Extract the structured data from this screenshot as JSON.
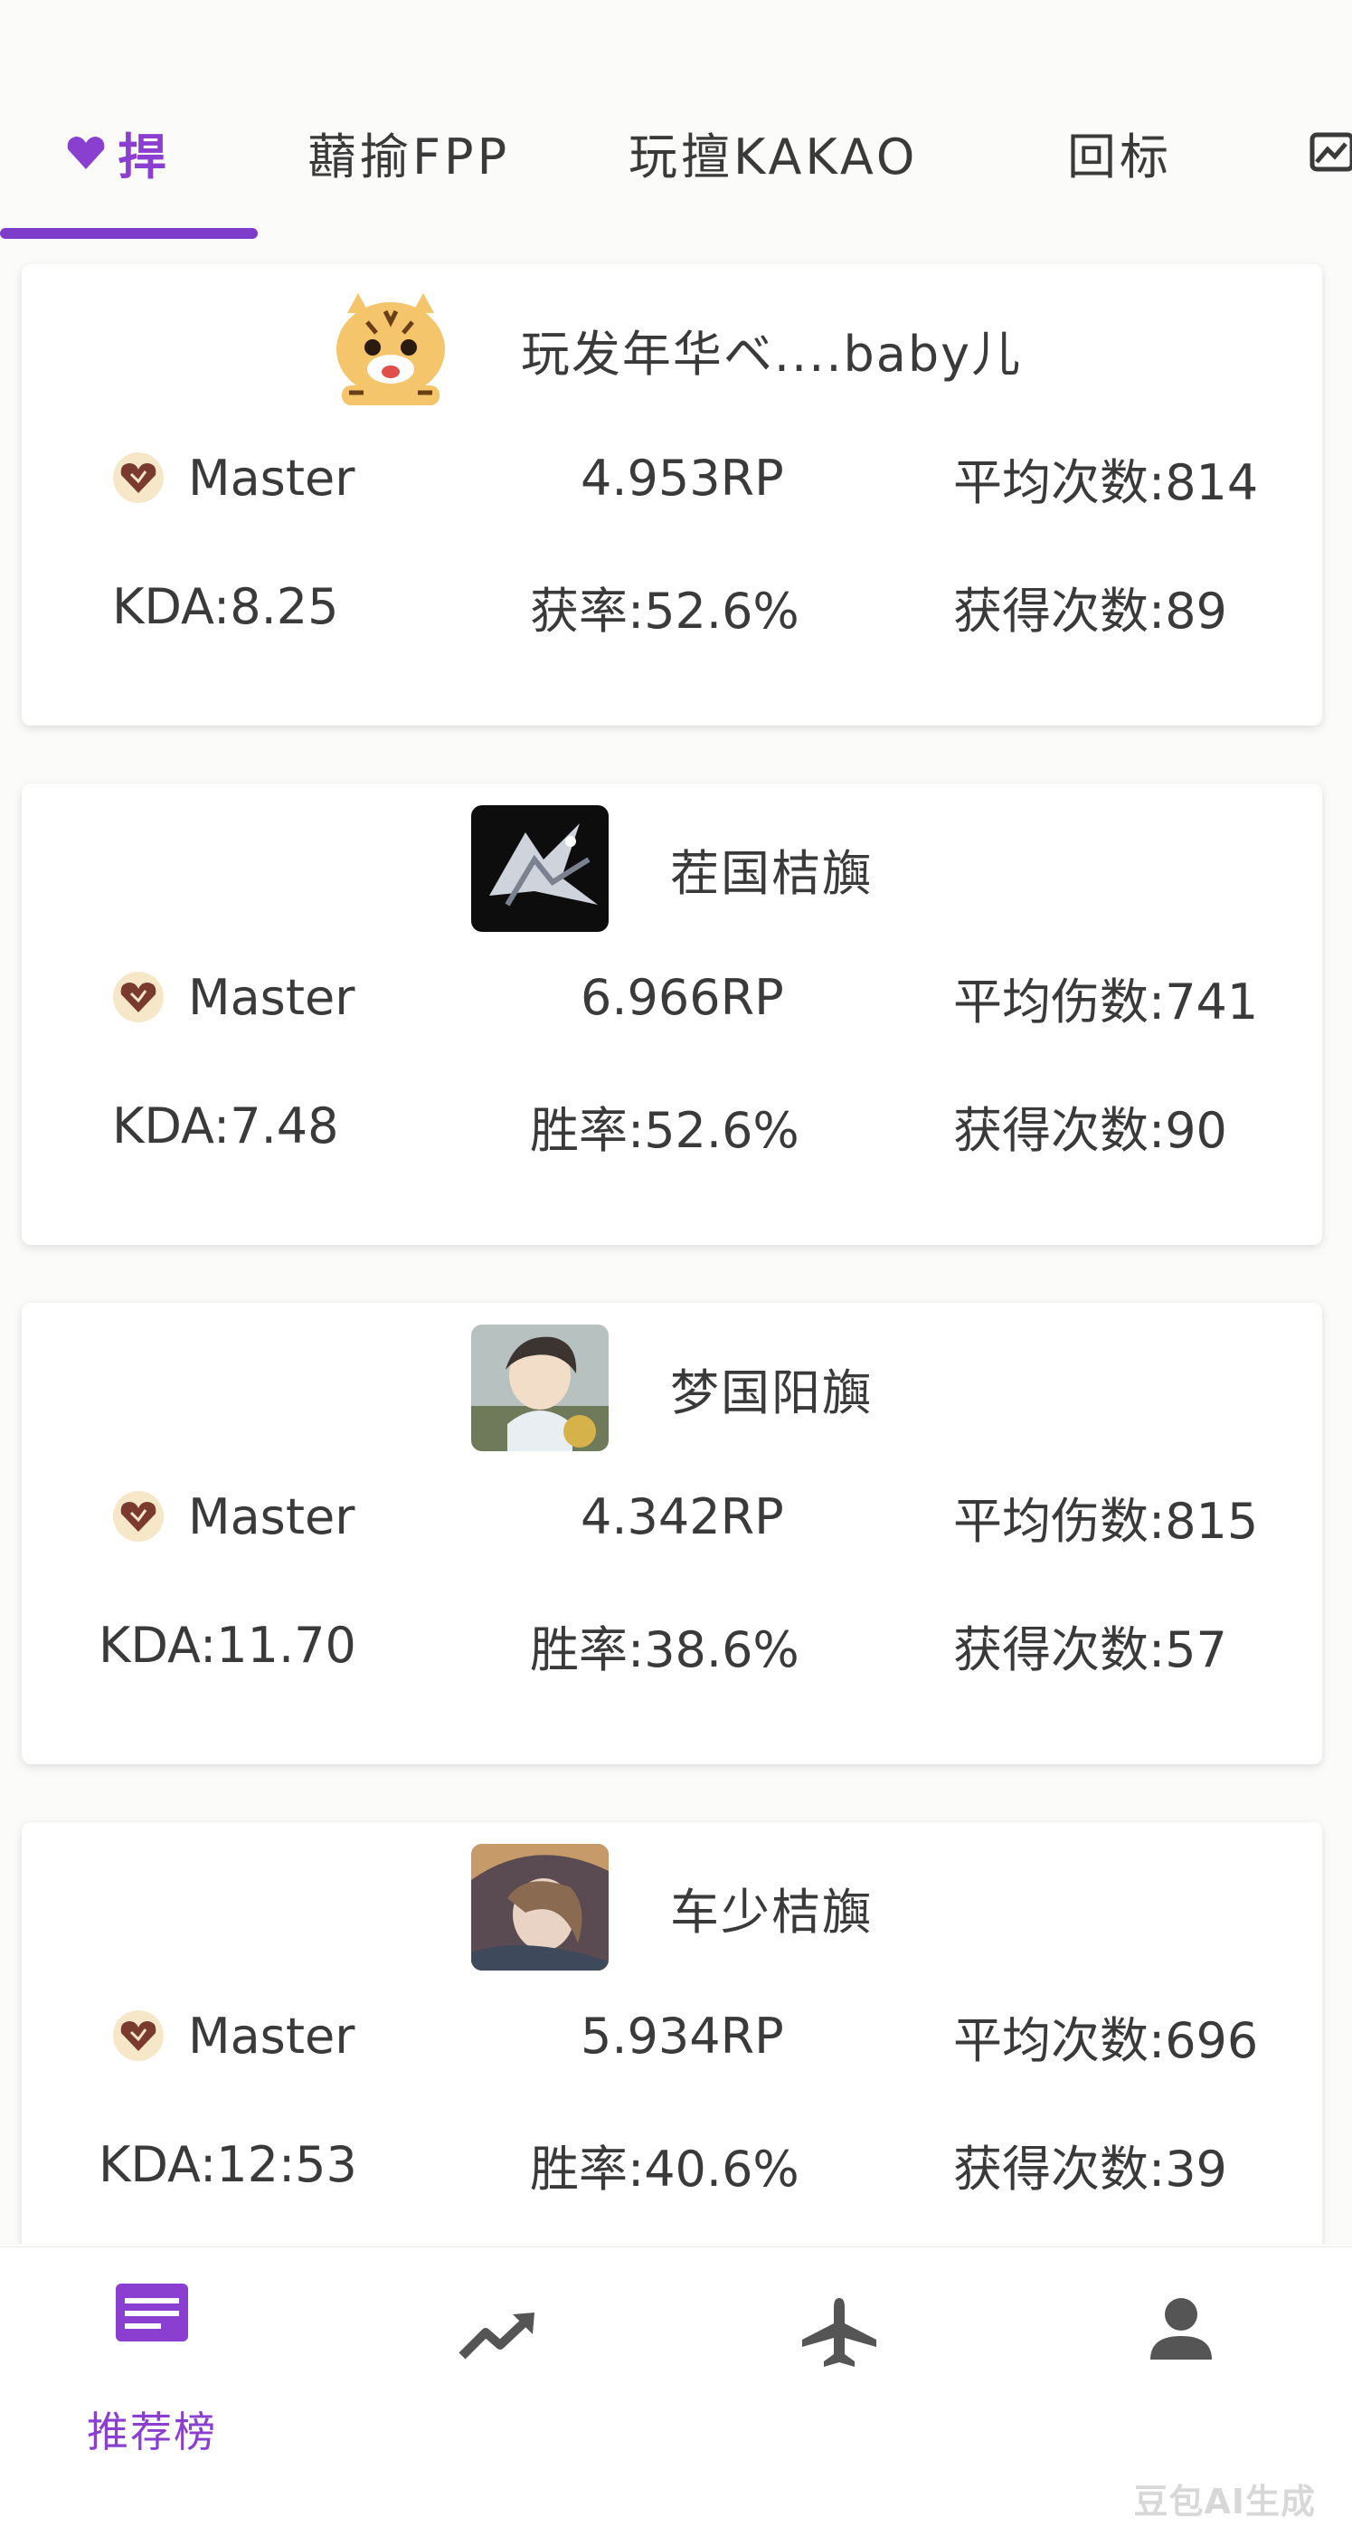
{
  "tabs": [
    {
      "label": "捍",
      "active": true,
      "icon": "heart-gem-icon"
    },
    {
      "label": "蘛揄FPP",
      "active": false
    },
    {
      "label": "玩擅KAKAO",
      "active": false
    },
    {
      "label": "回标",
      "active": false
    },
    {
      "label": "",
      "active": false,
      "icon": "chart-icon"
    }
  ],
  "players": [
    {
      "name": "玩发年华ベ....baby儿",
      "avatar": "tiger-cartoon-avatar",
      "tier": "Master",
      "rp": "4.953RP",
      "avg_stat": "平均次数:814",
      "kda": "KDA:8.25",
      "rate": "获率:52.6%",
      "count": "获得次数:89"
    },
    {
      "name": "茬国桔旟",
      "avatar": "dark-dragon-avatar",
      "tier": "Master",
      "rp": "6.966RP",
      "avg_stat": "平均伤数:741",
      "kda": "KDA:7.48",
      "rate": "胜率:52.6%",
      "count": "获得次数:90"
    },
    {
      "name": "梦国阳旟",
      "avatar": "anime-girl-avatar",
      "tier": "Master",
      "rp": "4.342RP",
      "avg_stat": "平均伤数:815",
      "kda": "KDA:11.70",
      "rate": "胜率:38.6%",
      "count": "获得次数:57"
    },
    {
      "name": "车少桔旟",
      "avatar": "hat-character-avatar",
      "tier": "Master",
      "rp": "5.934RP",
      "avg_stat": "平均次数:696",
      "kda": "KDA:12:53",
      "rate": "胜率:40.6%",
      "count": "获得次数:39"
    }
  ],
  "bottom_nav": [
    {
      "label": "推荐榜",
      "icon": "list-icon",
      "active": true
    },
    {
      "label": "",
      "icon": "trending-icon",
      "active": false
    },
    {
      "label": "",
      "icon": "airplane-icon",
      "active": false
    },
    {
      "label": "",
      "icon": "person-icon",
      "active": false
    }
  ],
  "watermark": "豆包AI生成",
  "colors": {
    "accent": "#8a3fd1",
    "indicator": "#7d3cc9",
    "tier_badge": "#7a3b2e",
    "nav_icon": "#555555"
  }
}
